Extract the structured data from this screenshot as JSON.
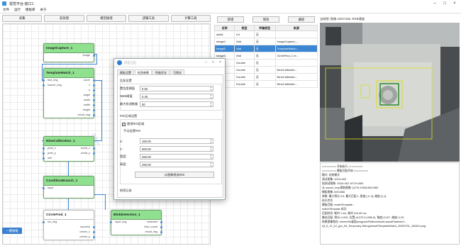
{
  "window": {
    "title": "视觉平台-窗口1"
  },
  "menu": [
    "文件",
    "运行",
    "模板库",
    "关于"
  ],
  "toolbar": [
    "采集",
    "前处理",
    "模型推理",
    "逻辑工具",
    "计算工具"
  ],
  "canvas": {
    "watermark": "A",
    "expand_label": "一键收缩"
  },
  "nodes": {
    "capture": {
      "title": "ImageCapture_1",
      "out": [
        "image"
      ]
    },
    "match": {
      "title": "TemplateMatch_1",
      "in": [
        "test_img",
        "source_img"
      ],
      "out": [
        "score",
        "x",
        "y",
        "angle",
        "scale",
        "width",
        "height",
        "result_img"
      ]
    },
    "nine": {
      "title": "NineCalibration_1",
      "in": [
        "pixel_x",
        "pixel_y",
        "unit"
      ],
      "out": [
        "world_x",
        "world_y"
      ]
    },
    "branch": {
      "title": "ConditionBranch_1",
      "in": [
        "input"
      ]
    },
    "circle": {
      "title": "CircleFind_1",
      "in": [
        "src_img"
      ],
      "out": [
        "success",
        "center_x",
        "center_y"
      ]
    },
    "blob": {
      "title": "BlobDetection_1",
      "in": [
        "input_img"
      ],
      "out": [
        "detected",
        "blob_count",
        "result_img"
      ]
    }
  },
  "right_buttons": [
    "新增",
    "修改",
    "删除"
  ],
  "vars": {
    "headers": [
      "名称",
      "类型",
      "传输类型",
      "来源"
    ],
    "rows": [
      [
        "data1",
        "Int",
        "无",
        ""
      ],
      [
        "image1",
        "Mat",
        "无",
        "ImageCapture_..."
      ],
      [
        "image2",
        "Mat",
        "无",
        "TemplateMatch..."
      ],
      [
        "image3",
        "Mat",
        "无",
        "CircleFind_1.re..."
      ],
      [
        "x1",
        "Double",
        "无",
        ""
      ],
      [
        "y1",
        "Double",
        "无",
        "NineCalibratio..."
      ],
      [
        "x2",
        "Double",
        "无",
        "NineCalibratio..."
      ],
      [
        "y2",
        "Double",
        "无",
        "NineCalibratio..."
      ]
    ],
    "selected": 2
  },
  "image": {
    "info": "当前图: 图像 1024×402, RGB通道"
  },
  "log": [
    "========= 开始执行 =========",
    "========= 模板匹配开始 =========",
    "模式: 仿射模式",
    "测试图像: 1024×402",
    "指测试图像: 1024×402 1573×1563",
    "从 source_img 图取图像: [1276,1050] 693×666",
    "模板图像: 693×666",
    "参数: 最小得分 0.5, 最大匹配 1, 角度 [-0, 0], 缩放 [1,1]",
    "执行完毕",
    "模板匹配: matchTemplate...",
    "matchTemplate 成功",
    "匹配时间: 耗时 1 ms, 耗时 115.40 ms",
    "最佳匹配: 得分=1.000, 位置=(1270.3,1056.0), 角度=0.00°, 缩放=1.00",
    "结果图像保存: /home/Hk桌面/program/Platform/build-visualPlatform/1-",
    "Qt_5_12_12_gcc_64_Temporary-Debug/result/TemplateMatch_20250701_162814.png"
  ],
  "dialog": {
    "name": "模板匹配",
    "tabs": [
      "模板设置",
      "检测参数",
      "性能优化",
      "可视化"
    ],
    "active_tab": 1,
    "match_section": "匹配设置",
    "fields": [
      {
        "label": "置信度阈值",
        "value": "0.50"
      },
      {
        "label": "NMS阈值",
        "value": "0.45"
      },
      {
        "label": "最大检测数量",
        "value": "50"
      }
    ],
    "roi_section": "ROI区域设置",
    "roi_check": "使用ROI区域",
    "roi_check_mark": "✓",
    "roi_sub": "手动设置ROI",
    "roi": [
      {
        "label": "X:",
        "value": "150.00"
      },
      {
        "label": "Y:",
        "value": "600.00"
      },
      {
        "label": "宽度:",
        "value": "250.00"
      },
      {
        "label": "高度:",
        "value": "250.00"
      }
    ],
    "roi_button": "从图像框选ROI",
    "viz_section": "框图记录"
  },
  "colors": {
    "accent": "#3b86d2",
    "node_head": "#8fe08f"
  },
  "icons": [
    "app-icon",
    "minimize-icon",
    "maximize-icon",
    "close-icon",
    "spin-up-icon",
    "spin-down-icon",
    "checkbox-icon",
    "dialog-logo-icon"
  ]
}
